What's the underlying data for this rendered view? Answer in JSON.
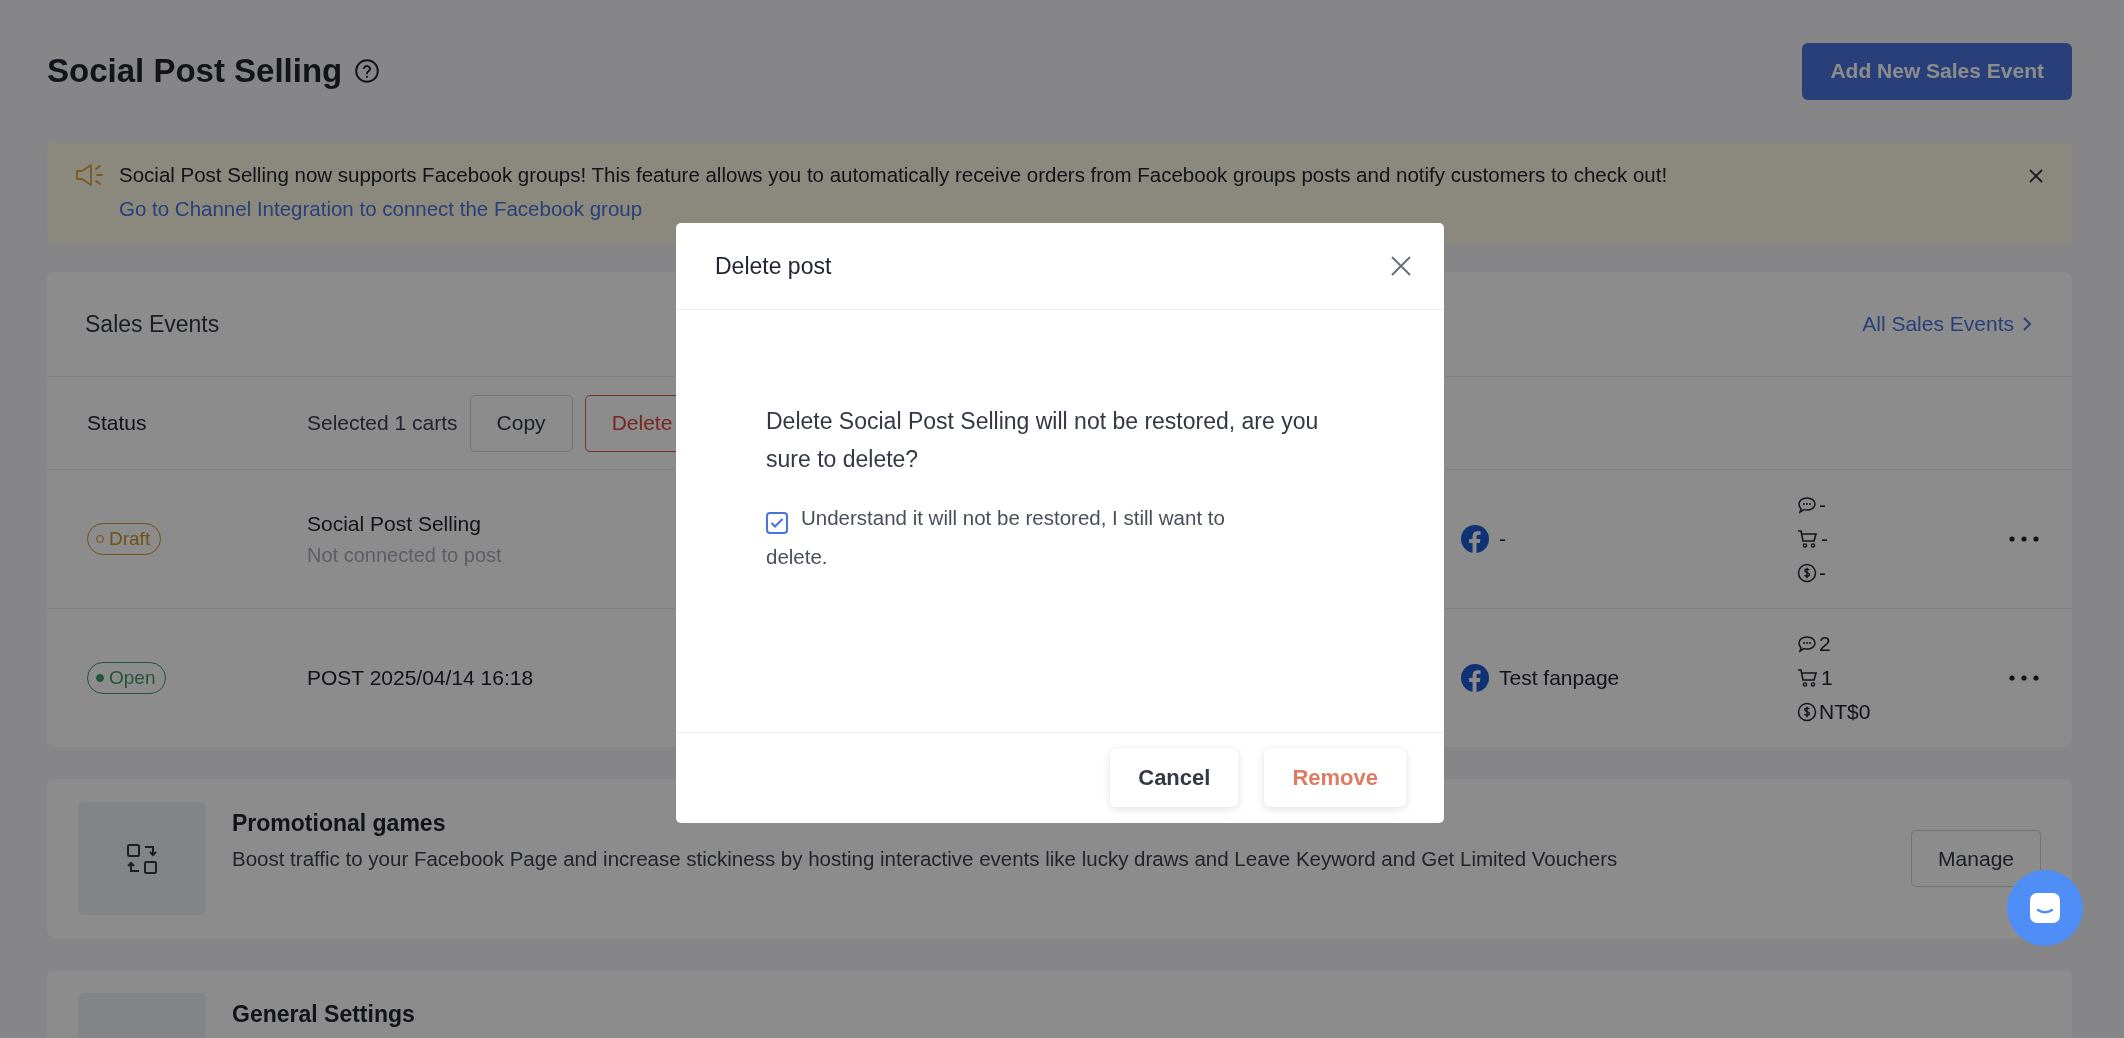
{
  "page": {
    "title": "Social Post Selling",
    "primary_button": "Add New Sales Event"
  },
  "banner": {
    "text": "Social Post Selling now supports Facebook groups! This feature allows you to automatically receive orders from Facebook groups posts and notify customers to check out!",
    "link": "Go to Channel Integration to connect the Facebook group"
  },
  "sales_events": {
    "title": "Sales Events",
    "link": "All Sales Events",
    "columns": {
      "status": "Status",
      "selection": "Selected 1 carts"
    },
    "bulk_actions": [
      {
        "label": "Copy",
        "kind": "default"
      },
      {
        "label": "Delete",
        "kind": "danger"
      }
    ],
    "rows": [
      {
        "status": {
          "label": "Draft",
          "kind": "draft"
        },
        "name": "Social Post Selling",
        "subtitle": "Not connected to post",
        "page": "-",
        "stats": [
          {
            "kind": "comments",
            "value": "-"
          },
          {
            "kind": "carts",
            "value": "-"
          },
          {
            "kind": "revenue",
            "value": "-"
          }
        ]
      },
      {
        "status": {
          "label": "Open",
          "kind": "open"
        },
        "name": "POST 2025/04/14 16:18",
        "page": "Test fanpage",
        "stats": [
          {
            "kind": "comments",
            "value": "2"
          },
          {
            "kind": "carts",
            "value": "1"
          },
          {
            "kind": "revenue",
            "value": "NT$0"
          }
        ]
      }
    ]
  },
  "feature_cards": [
    {
      "title": "Promotional games",
      "description": "Boost traffic to your Facebook Page and increase stickiness by hosting interactive events like lucky draws and Leave Keyword and Get Limited Vouchers",
      "button": "Manage"
    },
    {
      "title": "General Settings"
    }
  ],
  "dialog": {
    "title": "Delete post",
    "message": "Delete Social Post Selling will not be restored, are you sure to delete?",
    "confirm": {
      "label": "Understand it will not be restored, I still want to delete.",
      "checked": true
    },
    "buttons": [
      {
        "label": "Cancel",
        "kind": "default"
      },
      {
        "label": "Remove",
        "kind": "danger"
      }
    ]
  }
}
